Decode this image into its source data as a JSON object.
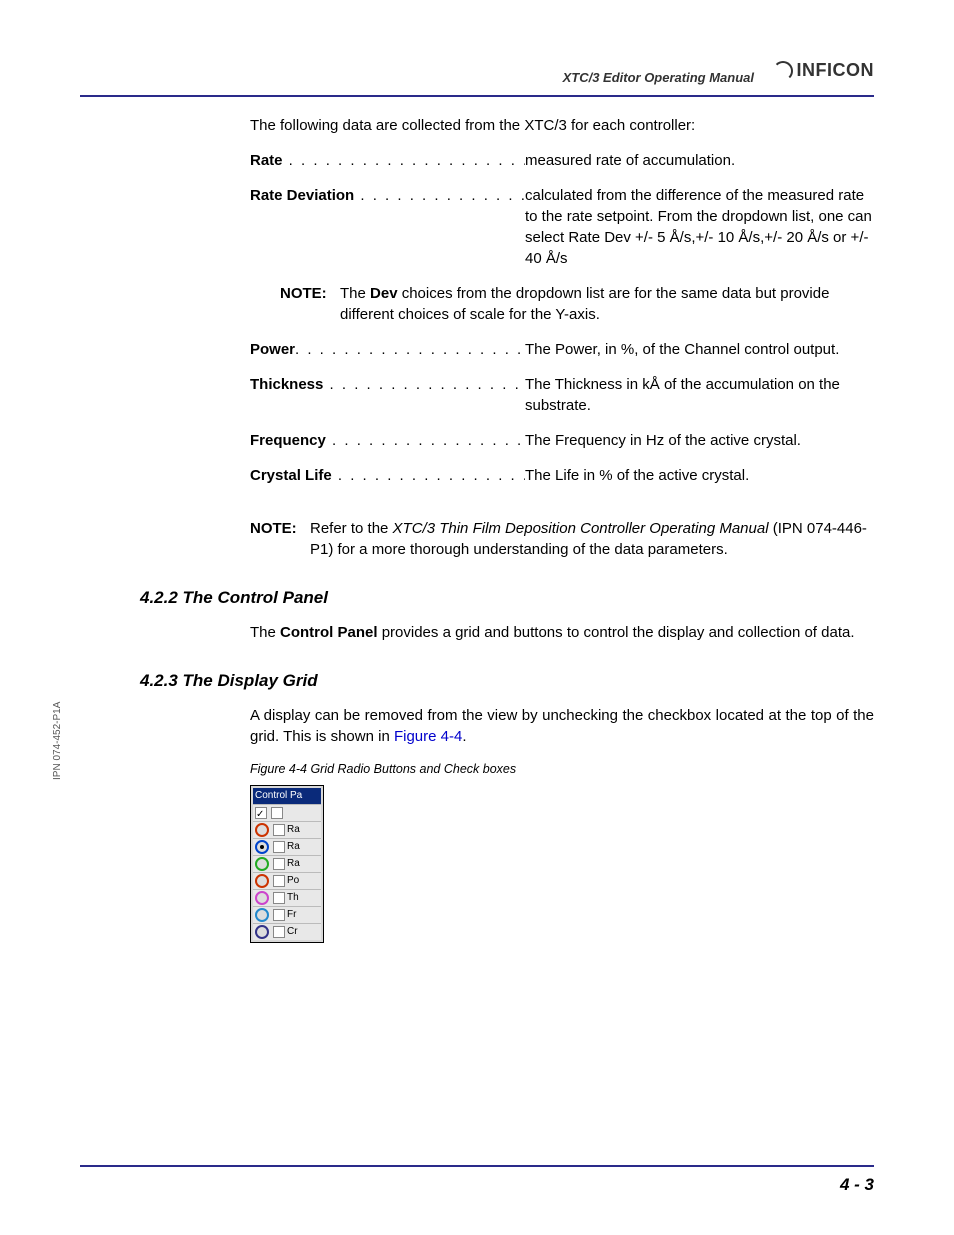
{
  "header": {
    "doc_title": "XTC/3 Editor Operating Manual",
    "brand": "INFICON"
  },
  "intro": "The following data are collected from the XTC/3 for each controller:",
  "definitions": [
    {
      "term": "Rate",
      "dots": " . . . . . . . . . . . . . . . . . . . . . . . . .",
      "desc": "measured rate of accumulation."
    },
    {
      "term": "Rate Deviation",
      "dots": "  . . . . . . . . . . . . . . . .",
      "desc": "calculated from the difference of the measured rate to the rate setpoint. From the dropdown list, one can select Rate Dev +/- 5 Å/s,+/- 10 Å/s,+/- 20 Å/s or +/- 40 Å/s"
    }
  ],
  "note1": {
    "label": "NOTE:",
    "prefix": "The ",
    "bold": "Dev",
    "suffix": " choices from the dropdown list are for the same data but provide different choices of scale for the Y-axis."
  },
  "definitions2": [
    {
      "term": "Power",
      "dots": ". . . . . . . . . . . . . . . . . . . . . . . . .",
      "desc": "The Power, in %, of the Channel control output."
    },
    {
      "term": "Thickness",
      "dots": " . . . . . . . . . . . . . . . . . . . .",
      "desc": "The Thickness in kÅ of the accumulation on the substrate."
    },
    {
      "term": "Frequency",
      "dots": " . . . . . . . . . . . . . . . . . . . .",
      "desc": "The Frequency in Hz of the active crystal."
    },
    {
      "term": "Crystal Life",
      "dots": " . . . . . . . . . . . . . . . . . . .",
      "desc": "The Life in % of the active crystal."
    }
  ],
  "note2": {
    "label": "NOTE:",
    "prefix": "Refer to the ",
    "ital": "XTC/3 Thin Film Deposition Controller Operating Manual",
    "suffix": " (IPN 074-446-P1) for a more thorough understanding of the data parameters."
  },
  "section_422": {
    "heading": "4.2.2  The Control Panel",
    "para_prefix": "The ",
    "para_bold": "Control Panel",
    "para_suffix": " provides a grid and buttons to control the display and collection of data."
  },
  "section_423": {
    "heading": "4.2.3  The Display Grid",
    "para_prefix": "A display can be removed from the view by unchecking the checkbox located at the top of the grid. This is shown in ",
    "fig_link": "Figure 4-4",
    "para_suffix": ".",
    "fig_caption": "Figure 4-4  Grid Radio Buttons and Check boxes"
  },
  "figure": {
    "title": "Control Pa",
    "rows": [
      {
        "color": "#cc3300",
        "selected": false,
        "label": "Ra"
      },
      {
        "color": "#0044cc",
        "selected": true,
        "label": "Ra"
      },
      {
        "color": "#22aa22",
        "selected": false,
        "label": "Ra"
      },
      {
        "color": "#cc3300",
        "selected": false,
        "label": "Po"
      },
      {
        "color": "#cc44cc",
        "selected": false,
        "label": "Th"
      },
      {
        "color": "#2288cc",
        "selected": false,
        "label": "Fr"
      },
      {
        "color": "#333388",
        "selected": false,
        "label": "Cr"
      }
    ]
  },
  "side_text": "IPN 074-452-P1A",
  "page_number": "4 - 3"
}
